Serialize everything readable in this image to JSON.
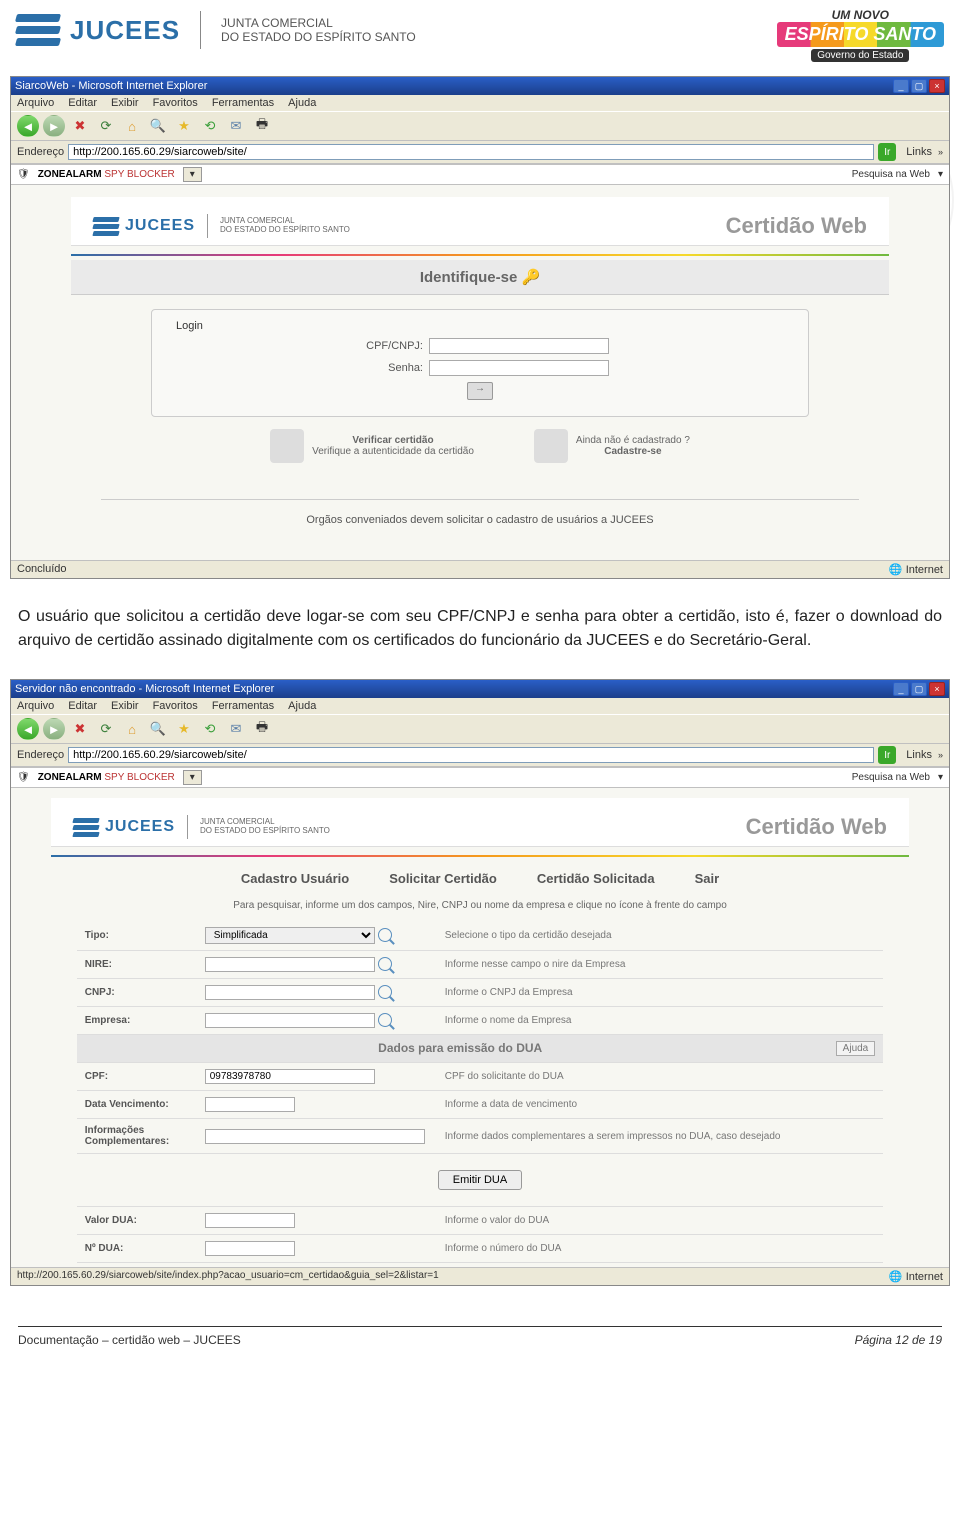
{
  "header": {
    "brand": "JUCEES",
    "brand_sub1": "JUNTA COMERCIAL",
    "brand_sub2": "DO ESTADO DO ESPÍRITO SANTO",
    "novo_top": "UM NOVO",
    "novo_brand": "ESPÍRITO SANTO",
    "novo_sub": "Governo do Estado"
  },
  "screenshot1": {
    "title": "SiarcoWeb - Microsoft Internet Explorer",
    "menu": [
      "Arquivo",
      "Editar",
      "Exibir",
      "Favoritos",
      "Ferramentas",
      "Ajuda"
    ],
    "address_label": "Endereço",
    "url": "http://200.165.60.29/siarcoweb/site/",
    "links_label": "Links",
    "zonealarm_brand": "ZONEALARM",
    "zonealarm_spy": "SPY BLOCKER",
    "zonealarm_search": "Pesquisa na Web",
    "cert_title": "Certidão Web",
    "identify": "Identifique-se",
    "login_legend": "Login",
    "cpf_label": "CPF/CNPJ:",
    "senha_label": "Senha:",
    "verify": {
      "title": "Verificar certidão",
      "sub": "Verifique a autenticidade da certidão"
    },
    "cadastro": {
      "title": "Ainda não é cadastrado ?",
      "sub": "Cadastre-se"
    },
    "footer_note": "Orgãos conveniados devem solicitar o cadastro de usuários a JUCEES",
    "status_left": "Concluído",
    "status_right": "Internet"
  },
  "paragraph": "O usuário que solicitou a certidão deve logar-se com seu CPF/CNPJ e senha para obter a certidão, isto é, fazer o download do arquivo de certidão assinado digitalmente com os certificados do funcionário da JUCEES e do Secretário-Geral.",
  "screenshot2": {
    "title": "Servidor não encontrado - Microsoft Internet Explorer",
    "menu": [
      "Arquivo",
      "Editar",
      "Exibir",
      "Favoritos",
      "Ferramentas",
      "Ajuda"
    ],
    "address_label": "Endereço",
    "url": "http://200.165.60.29/siarcoweb/site/",
    "links_label": "Links",
    "zonealarm_brand": "ZONEALARM",
    "zonealarm_spy": "SPY BLOCKER",
    "zonealarm_search": "Pesquisa na Web",
    "cert_title": "Certidão Web",
    "tabs": [
      "Cadastro Usuário",
      "Solicitar Certidão",
      "Certidão Solicitada",
      "Sair"
    ],
    "search_hint": "Para pesquisar, informe um dos campos, Nire, CNPJ ou nome da empresa e clique no ícone à frente do campo",
    "rows": {
      "tipo_label": "Tipo:",
      "tipo_value": "Simplificada",
      "tipo_help": "Selecione o tipo da certidão desejada",
      "nire_label": "NIRE:",
      "nire_help": "Informe nesse campo o nire da Empresa",
      "cnpj_label": "CNPJ:",
      "cnpj_help": "Informe o CNPJ da Empresa",
      "empresa_label": "Empresa:",
      "empresa_help": "Informe o nome da Empresa"
    },
    "dua_section": "Dados para emissão do DUA",
    "ajuda": "Ajuda",
    "dua": {
      "cpf_label": "CPF:",
      "cpf_value": "09783978780",
      "cpf_help": "CPF do solicitante do DUA",
      "venc_label": "Data Vencimento:",
      "venc_help": "Informe a data de vencimento",
      "info_label": "Informações Complementares:",
      "info_help": "Informe dados complementares a serem impressos no DUA, caso desejado",
      "emit": "Emitir DUA",
      "valor_label": "Valor DUA:",
      "valor_help": "Informe o valor do DUA",
      "num_label": "Nº DUA:",
      "num_help": "Informe o número do DUA"
    },
    "status_left": "http://200.165.60.29/siarcoweb/site/index.php?acao_usuario=cm_certidao&guia_sel=2&listar=1",
    "status_right": "Internet"
  },
  "footer": {
    "left": "Documentação – certidão web – JUCEES",
    "right_prefix": "Página ",
    "page_cur": "12",
    "right_mid": " de ",
    "page_total": "19"
  }
}
